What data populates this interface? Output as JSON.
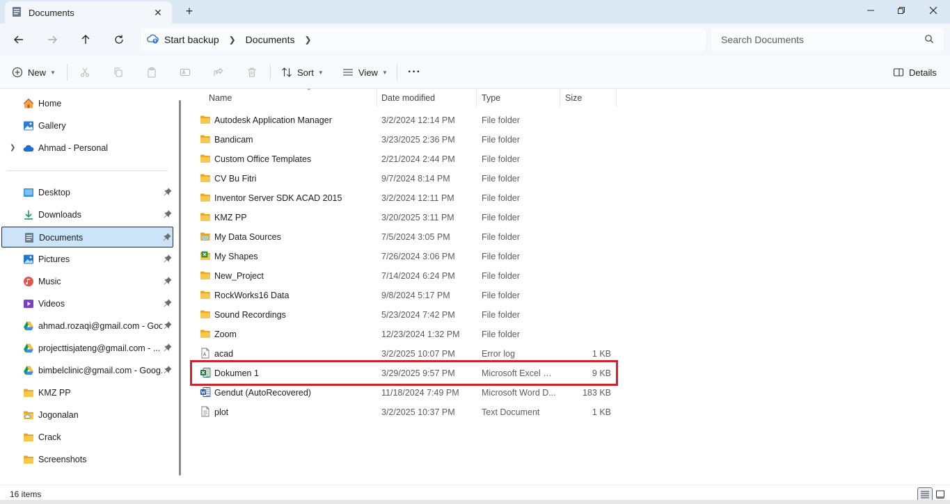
{
  "window": {
    "tab_title": "Documents",
    "tab_close": "✕",
    "new_tab": "+"
  },
  "address": {
    "crumbs": [
      "Start backup",
      "Documents"
    ],
    "search_placeholder": "Search Documents"
  },
  "toolbar": {
    "new_label": "New",
    "sort_label": "Sort",
    "view_label": "View",
    "more_label": "···",
    "details_label": "Details"
  },
  "sidebar": {
    "top": [
      {
        "label": "Home",
        "icon": "home-icon"
      },
      {
        "label": "Gallery",
        "icon": "gallery-icon"
      },
      {
        "label": "Ahmad - Personal",
        "icon": "onedrive-icon"
      }
    ],
    "quick": [
      {
        "label": "Desktop",
        "icon": "desktop-icon"
      },
      {
        "label": "Downloads",
        "icon": "downloads-icon"
      },
      {
        "label": "Documents",
        "icon": "documents-icon"
      },
      {
        "label": "Pictures",
        "icon": "pictures-icon"
      },
      {
        "label": "Music",
        "icon": "music-icon"
      },
      {
        "label": "Videos",
        "icon": "videos-icon"
      },
      {
        "label": "ahmad.rozaqi@gmail.com - Google Drive",
        "icon": "google-drive-icon"
      },
      {
        "label": "projecttisjateng@gmail.com - ... (",
        "icon": "google-drive-icon"
      },
      {
        "label": "bimbelclinic@gmail.com - Goog...",
        "icon": "google-drive-icon"
      },
      {
        "label": "KMZ PP",
        "icon": "folder-icon"
      },
      {
        "label": "Jogonalan",
        "icon": "folder-icon"
      },
      {
        "label": "Crack",
        "icon": "folder-icon"
      },
      {
        "label": "Screenshots",
        "icon": "folder-icon"
      }
    ]
  },
  "columns": {
    "name": "Name",
    "date": "Date modified",
    "type": "Type",
    "size": "Size"
  },
  "files": [
    {
      "name": "Autodesk Application Manager",
      "date": "3/2/2024 12:14 PM",
      "type": "File folder",
      "size": "",
      "icon": "folder-icon"
    },
    {
      "name": "Bandicam",
      "date": "3/23/2025 2:36 PM",
      "type": "File folder",
      "size": "",
      "icon": "folder-icon"
    },
    {
      "name": "Custom Office Templates",
      "date": "2/21/2024 2:44 PM",
      "type": "File folder",
      "size": "",
      "icon": "folder-icon"
    },
    {
      "name": "CV Bu Fitri",
      "date": "9/7/2024 8:14 PM",
      "type": "File folder",
      "size": "",
      "icon": "folder-icon"
    },
    {
      "name": "Inventor Server SDK ACAD 2015",
      "date": "3/2/2024 12:11 PM",
      "type": "File folder",
      "size": "",
      "icon": "folder-icon"
    },
    {
      "name": "KMZ PP",
      "date": "3/20/2025 3:11 PM",
      "type": "File folder",
      "size": "",
      "icon": "folder-icon"
    },
    {
      "name": "My Data Sources",
      "date": "7/5/2024 3:05 PM",
      "type": "File folder",
      "size": "",
      "icon": "data-sources-folder-icon"
    },
    {
      "name": "My Shapes",
      "date": "7/26/2024 3:06 PM",
      "type": "File folder",
      "size": "",
      "icon": "shapes-folder-icon"
    },
    {
      "name": "New_Project",
      "date": "7/14/2024 6:24 PM",
      "type": "File folder",
      "size": "",
      "icon": "folder-icon"
    },
    {
      "name": "RockWorks16 Data",
      "date": "9/8/2024 5:17 PM",
      "type": "File folder",
      "size": "",
      "icon": "folder-icon"
    },
    {
      "name": "Sound Recordings",
      "date": "5/23/2024 7:42 PM",
      "type": "File folder",
      "size": "",
      "icon": "folder-icon"
    },
    {
      "name": "Zoom",
      "date": "12/23/2024 1:32 PM",
      "type": "File folder",
      "size": "",
      "icon": "folder-icon"
    },
    {
      "name": "acad",
      "date": "3/2/2025 10:07 PM",
      "type": "Error log",
      "size": "1 KB",
      "icon": "log-file-icon"
    },
    {
      "name": "Dokumen 1",
      "date": "3/29/2025 9:57 PM",
      "type": "Microsoft Excel W...",
      "size": "9 KB",
      "icon": "excel-file-icon"
    },
    {
      "name": "Gendut (AutoRecovered)",
      "date": "11/18/2024 7:49 PM",
      "type": "Microsoft Word D...",
      "size": "183 KB",
      "icon": "word-file-icon"
    },
    {
      "name": "plot",
      "date": "3/2/2025 10:37 PM",
      "type": "Text Document",
      "size": "1 KB",
      "icon": "text-file-icon"
    }
  ],
  "status": {
    "item_count": "16 items"
  },
  "colors": {
    "selected_bg": "#cce4f7",
    "highlight_border": "#d4202a",
    "folder_yellow": "#f5c24c",
    "excel_green": "#1d7044",
    "word_blue": "#2b579a"
  }
}
